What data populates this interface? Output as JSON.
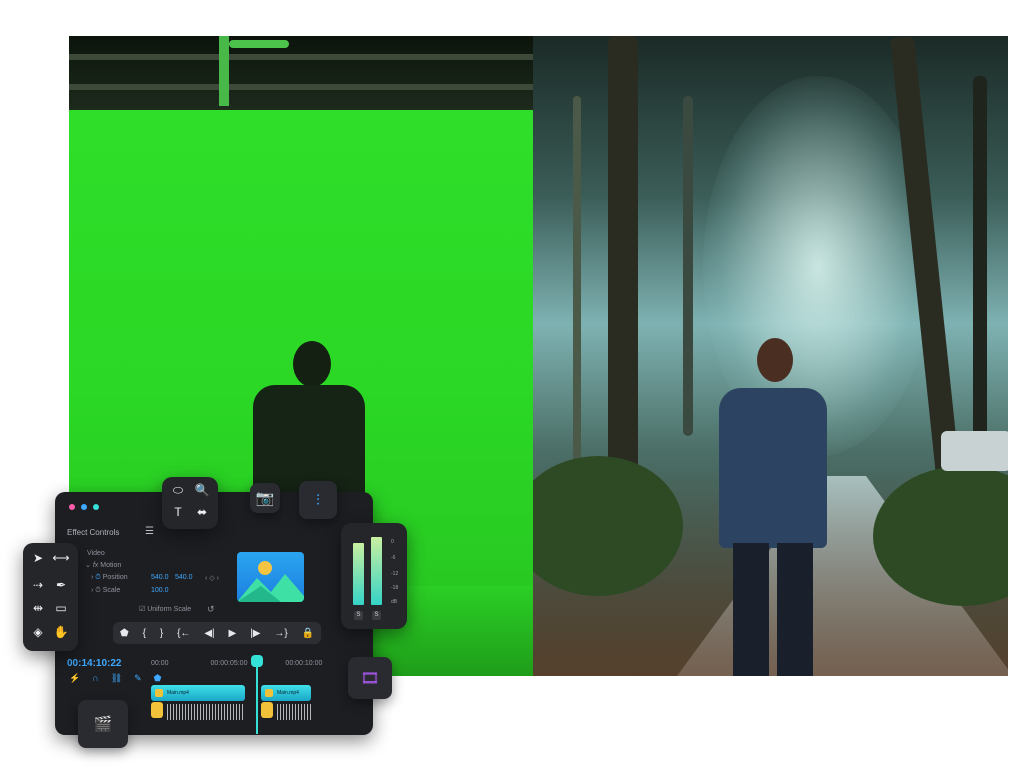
{
  "editor": {
    "panel_title": "Effect Controls",
    "section": "Video",
    "effect_name": "Motion",
    "position_label": "Position",
    "position_x": "540.0",
    "position_y": "540.0",
    "scale_label": "Scale",
    "scale_value": "100.0",
    "uniform_scale_label": "Uniform Scale",
    "timecode": "00:14:10:22",
    "ruler": [
      "00:00",
      "00:00:05:00",
      "00:00:10:00"
    ],
    "clip1_name": "Main.mp4",
    "clip2_name": "Main.mp4"
  },
  "meter": {
    "db_labels": [
      "0",
      "-6",
      "-12",
      "-18",
      "dB"
    ],
    "solo_left": "S",
    "solo_right": "S"
  },
  "colors": {
    "green_screen": "#2fe02a",
    "accent_blue": "#3ea9ff",
    "clip_cyan": "#3fe0e8",
    "playhead": "#35e0d6"
  }
}
